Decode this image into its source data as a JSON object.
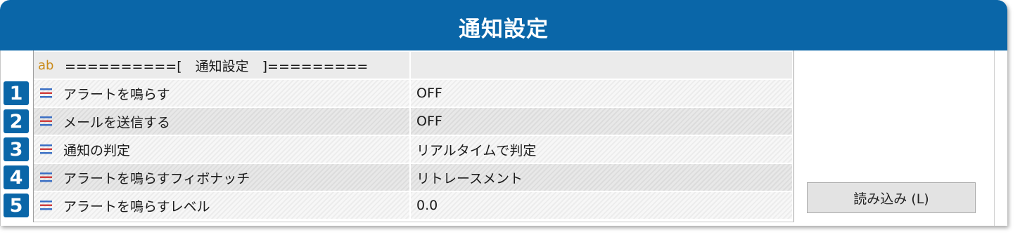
{
  "header": {
    "title": "通知設定"
  },
  "table": {
    "rows": [
      {
        "badge": "",
        "icon": "ab-icon",
        "icon_text": "ab",
        "name": "==========[　通知設定　]=========",
        "value": ""
      },
      {
        "badge": "1",
        "icon": "equals-icon",
        "name": "アラートを鳴らす",
        "value": "OFF"
      },
      {
        "badge": "2",
        "icon": "equals-icon",
        "name": "メールを送信する",
        "value": "OFF"
      },
      {
        "badge": "3",
        "icon": "equals-icon",
        "name": "通知の判定",
        "value": "リアルタイムで判定"
      },
      {
        "badge": "4",
        "icon": "equals-icon",
        "name": "アラートを鳴らすフィボナッチ",
        "value": "リトレースメント"
      },
      {
        "badge": "5",
        "icon": "equals-icon",
        "name": "アラートを鳴らすレベル",
        "value": "0.0"
      }
    ]
  },
  "load_button": {
    "label": "読み込み (L)"
  },
  "colors": {
    "accent": "#0a66a8",
    "ab_icon": "#c98a1a",
    "icon_blue": "#3b6fc4",
    "icon_red": "#d04040"
  }
}
